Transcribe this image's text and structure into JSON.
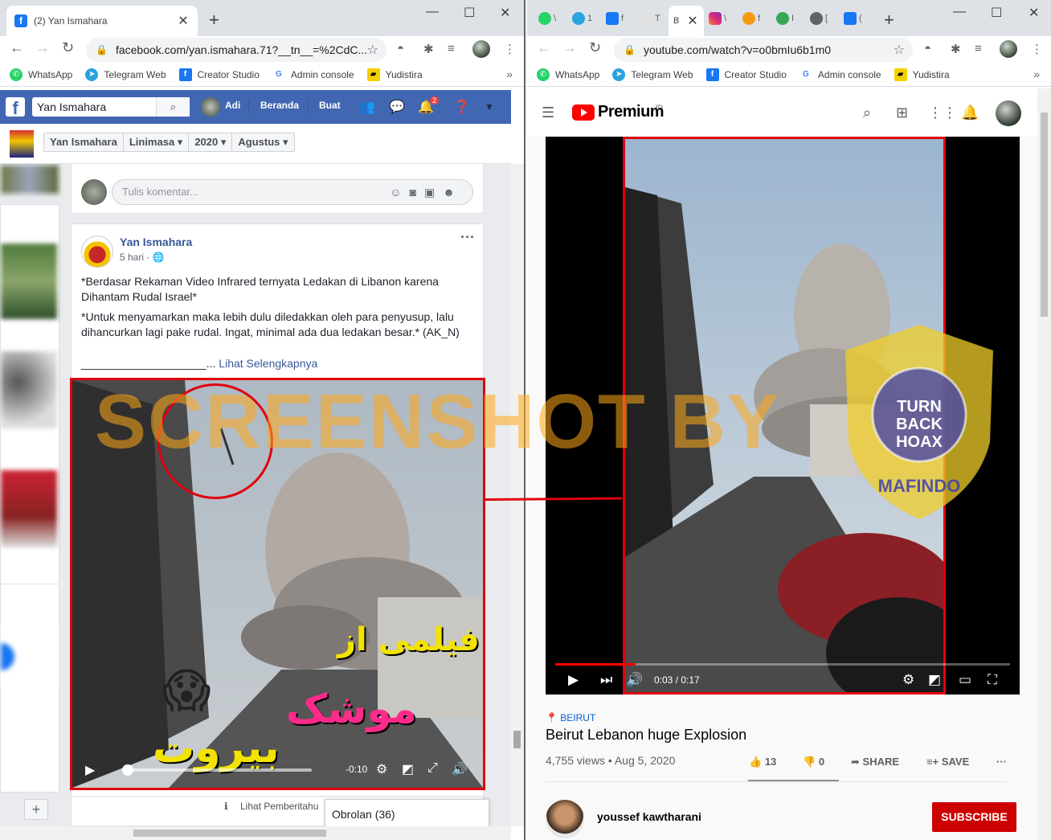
{
  "left": {
    "tab": {
      "title": "(2) Yan Ismahara",
      "favicon": "facebook-icon"
    },
    "url": "facebook.com/yan.ismahara.71?__tn__=%2CdC...",
    "bookmarks": [
      "WhatsApp",
      "Telegram Web",
      "Creator Studio",
      "Admin console",
      "Yudistira"
    ],
    "fb": {
      "search_value": "Yan Ismahara",
      "nav": {
        "profile": "Adi",
        "home": "Beranda",
        "create": "Buat"
      },
      "notif_count": "2",
      "crumbs": [
        "Yan Ismahara",
        "Linimasa",
        "2020",
        "Agustus"
      ],
      "comment_placeholder": "Tulis komentar...",
      "post": {
        "author": "Yan Ismahara",
        "time": "5 hari ·",
        "para1": "*Berdasar Rekaman Video Infrared ternyata Ledakan di Libanon karena Dihantam Rudal Israel*",
        "para2": "*Untuk menyamarkan maka lebih dulu diledakkan oleh para penyusup, lalu dihancurkan lagi pake rudal. Ingat, minimal ada dua ledakan besar.* (AK_N)",
        "underline": "____________________...",
        "see_more": "Lihat Selengkapnya"
      },
      "video": {
        "remaining": "-0:10",
        "overlay_line1": "فیلمی از",
        "overlay_line2": "موشک",
        "overlay_line3": "بیروت"
      },
      "bottom_notice": "Lihat Pemberitahu",
      "chat": "Obrolan (36)"
    }
  },
  "right": {
    "url": "youtube.com/watch?v=o0bmIu6b1m0",
    "bookmarks": [
      "WhatsApp",
      "Telegram Web",
      "Creator Studio",
      "Admin console",
      "Yudistira"
    ],
    "yt": {
      "brand": "Premium",
      "country": "ID",
      "time": "0:03 / 0:17",
      "played_fraction": 0.176,
      "tag": "BEIRUT",
      "title": "Beirut Lebanon huge Explosion",
      "meta": "4,755 views • Aug 5, 2020",
      "likes": "13",
      "dislikes": "0",
      "share": "SHARE",
      "save": "SAVE",
      "channel": "youssef kawtharani",
      "subscribe": "SUBSCRIBE"
    }
  },
  "overlay": {
    "watermark": "SCREENSHOT BY",
    "badge_text": "TURN BACK HOAX",
    "badge_org": "MAFINDO"
  },
  "colors": {
    "fb_blue": "#4267b2",
    "yt_red": "#ff0000",
    "highlight_red": "#e0000f"
  }
}
